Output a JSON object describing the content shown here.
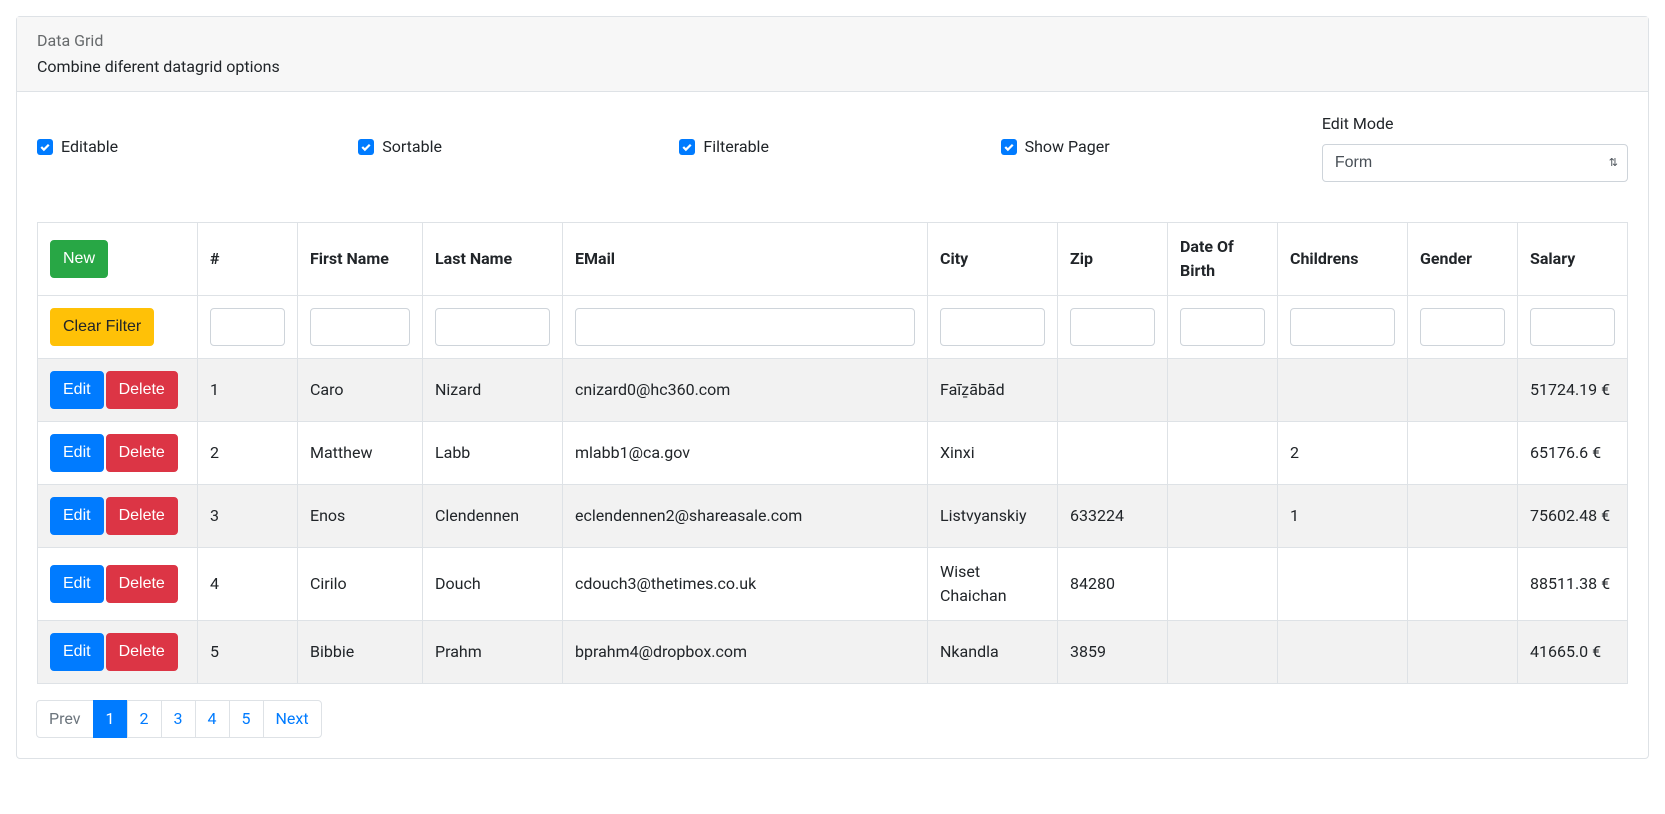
{
  "header": {
    "title": "Data Grid",
    "subtitle": "Combine diferent datagrid options"
  },
  "options": {
    "editable_label": "Editable",
    "sortable_label": "Sortable",
    "filterable_label": "Filterable",
    "show_pager_label": "Show Pager",
    "edit_mode_label": "Edit Mode",
    "edit_mode_value": "Form"
  },
  "buttons": {
    "new": "New",
    "clear_filter": "Clear Filter",
    "edit": "Edit",
    "delete": "Delete"
  },
  "columns": {
    "num": "#",
    "first_name": "First Name",
    "last_name": "Last Name",
    "email": "EMail",
    "city": "City",
    "zip": "Zip",
    "dob": "Date Of Birth",
    "childrens": "Childrens",
    "gender": "Gender",
    "salary": "Salary"
  },
  "rows": [
    {
      "num": "1",
      "first_name": "Caro",
      "last_name": "Nizard",
      "email": "cnizard0@hc360.com",
      "city": "Faīẕābād",
      "zip": "",
      "dob": "",
      "childrens": "",
      "gender": "",
      "salary": "51724.19 €"
    },
    {
      "num": "2",
      "first_name": "Matthew",
      "last_name": "Labb",
      "email": "mlabb1@ca.gov",
      "city": "Xinxi",
      "zip": "",
      "dob": "",
      "childrens": "2",
      "gender": "",
      "salary": "65176.6 €"
    },
    {
      "num": "3",
      "first_name": "Enos",
      "last_name": "Clendennen",
      "email": "eclendennen2@shareasale.com",
      "city": "Listvyanskiy",
      "zip": "633224",
      "dob": "",
      "childrens": "1",
      "gender": "",
      "salary": "75602.48 €"
    },
    {
      "num": "4",
      "first_name": "Cirilo",
      "last_name": "Douch",
      "email": "cdouch3@thetimes.co.uk",
      "city": "Wiset Chaichan",
      "zip": "84280",
      "dob": "",
      "childrens": "",
      "gender": "",
      "salary": "88511.38 €"
    },
    {
      "num": "5",
      "first_name": "Bibbie",
      "last_name": "Prahm",
      "email": "bprahm4@dropbox.com",
      "city": "Nkandla",
      "zip": "3859",
      "dob": "",
      "childrens": "",
      "gender": "",
      "salary": "41665.0 €"
    }
  ],
  "pagination": {
    "prev": "Prev",
    "next": "Next",
    "pages": [
      "1",
      "2",
      "3",
      "4",
      "5"
    ],
    "active_page": "1"
  }
}
